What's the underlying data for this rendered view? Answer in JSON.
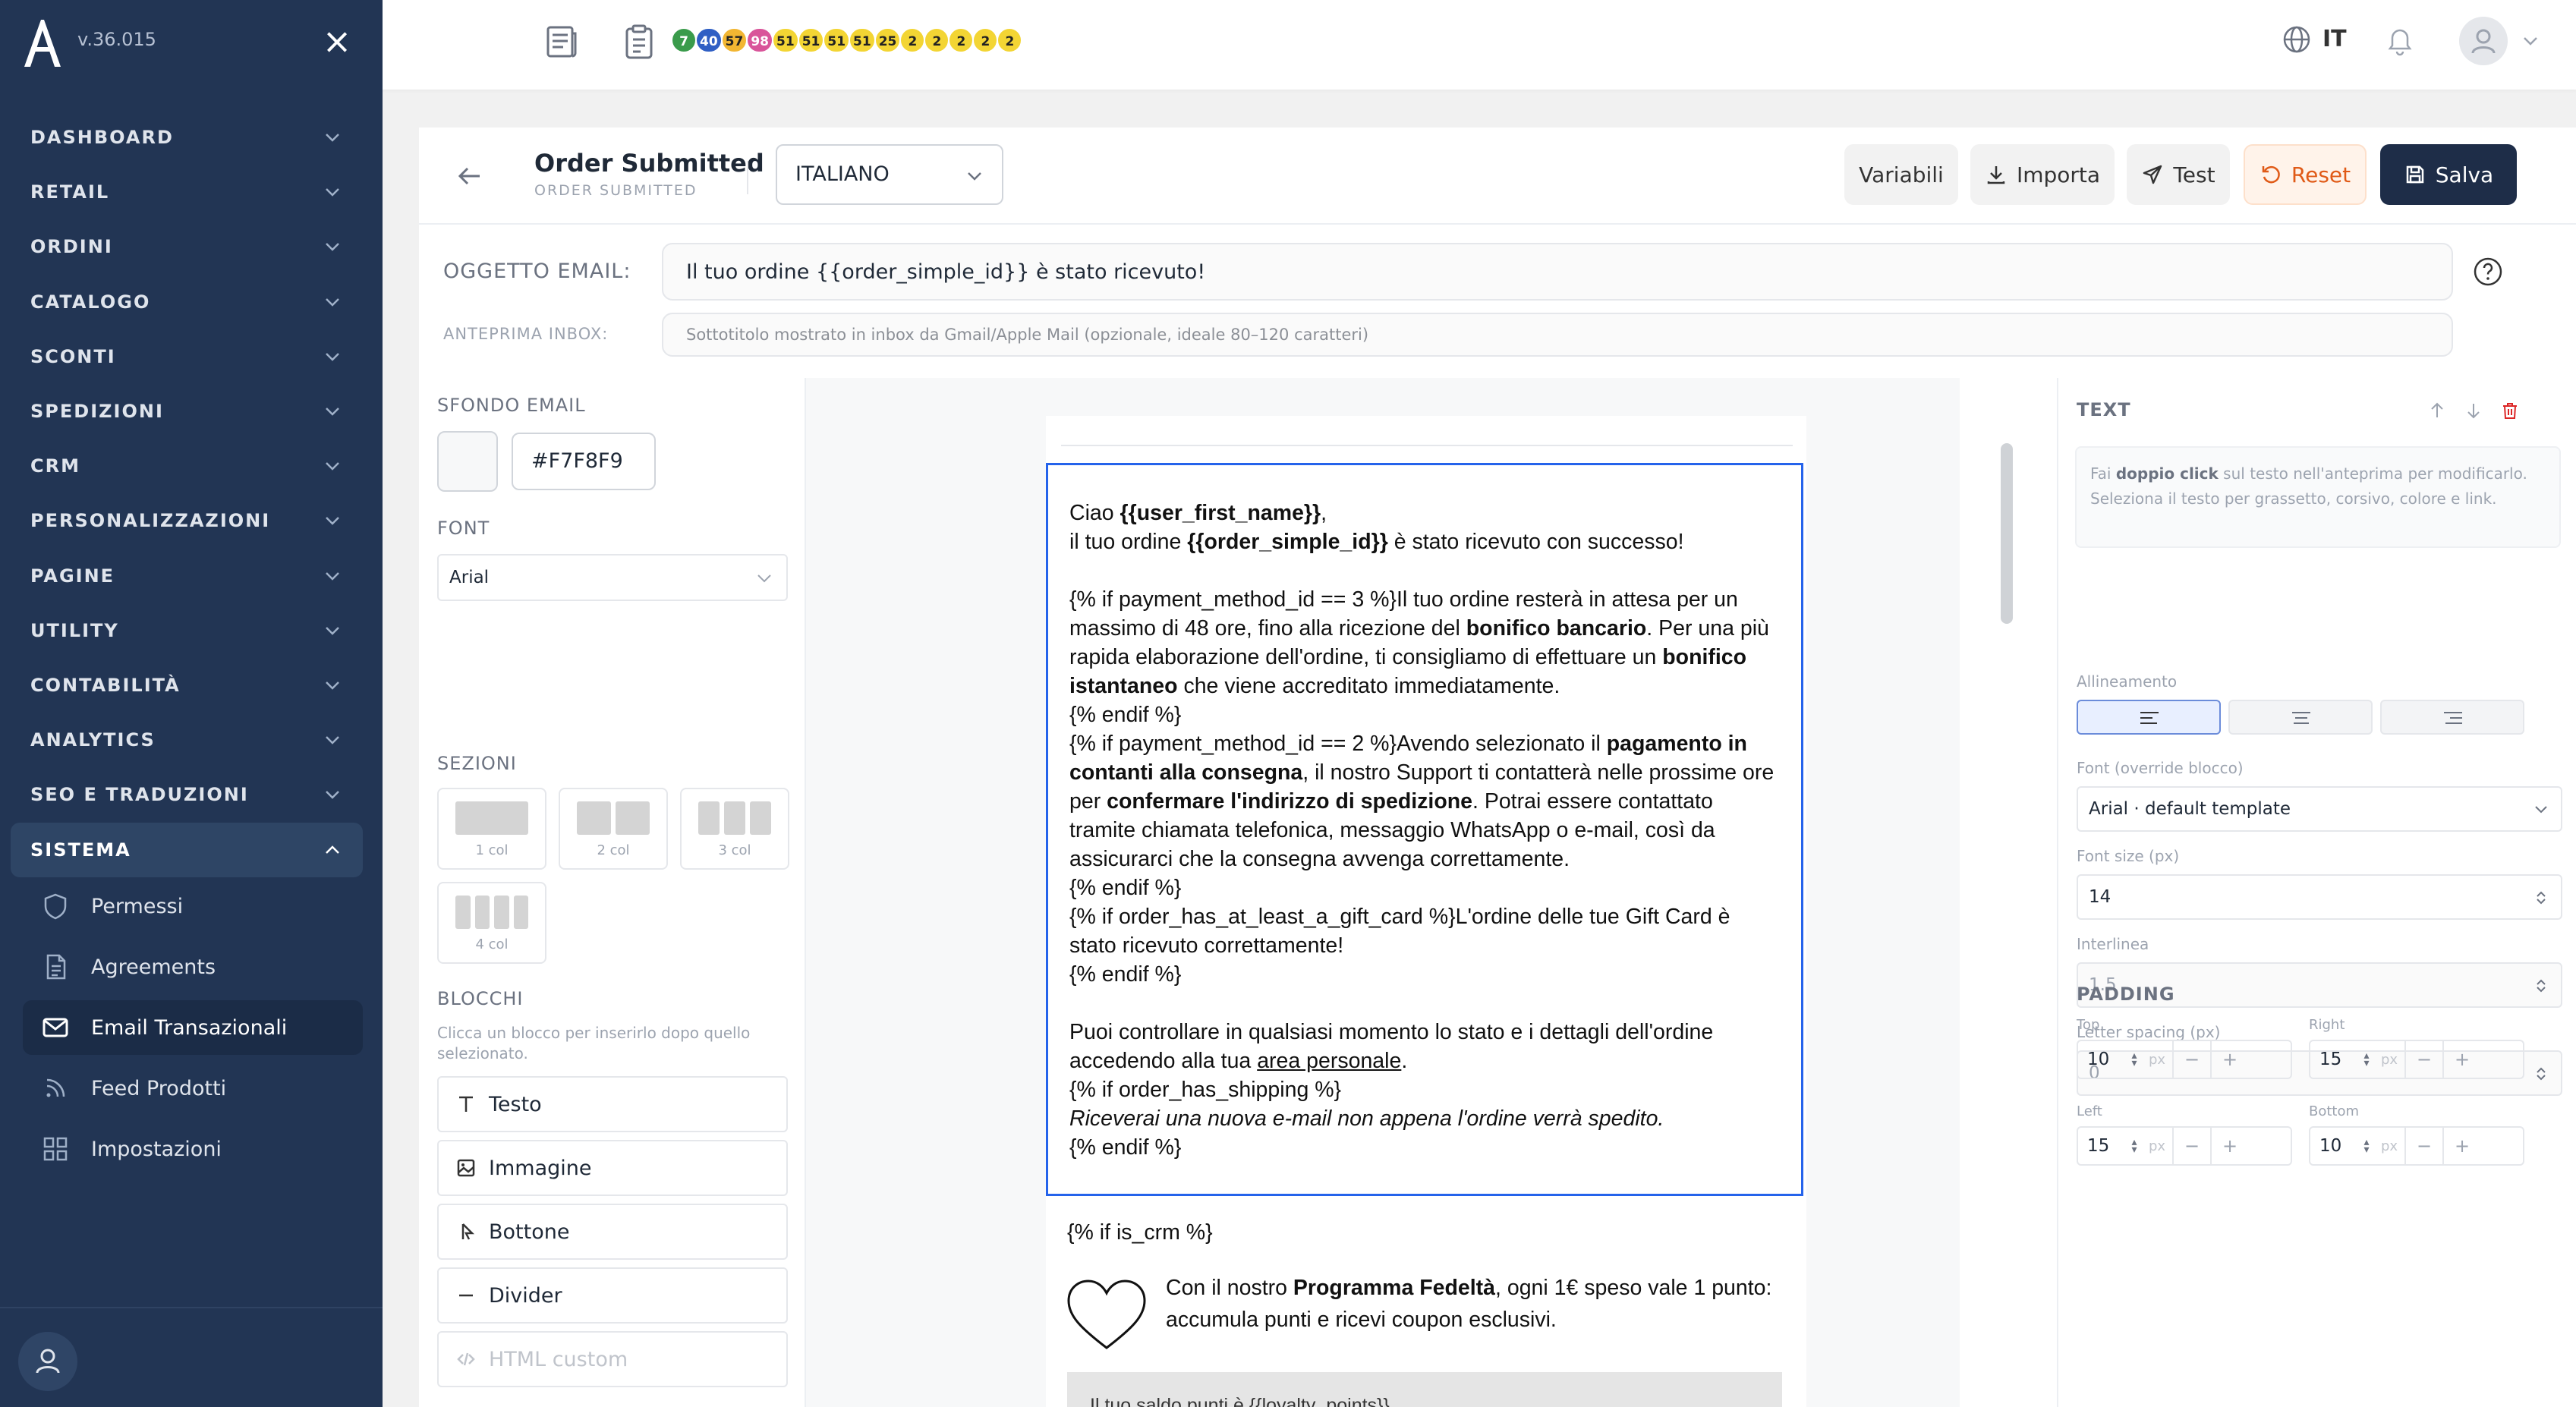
{
  "sidebar": {
    "version": "v.36.015",
    "nav": [
      {
        "label": "DASHBOARD"
      },
      {
        "label": "RETAIL"
      },
      {
        "label": "ORDINI"
      },
      {
        "label": "CATALOGO"
      },
      {
        "label": "SCONTI"
      },
      {
        "label": "SPEDIZIONI"
      },
      {
        "label": "CRM"
      },
      {
        "label": "PERSONALIZZAZIONI"
      },
      {
        "label": "PAGINE"
      },
      {
        "label": "UTILITY"
      },
      {
        "label": "CONTABILITÀ"
      },
      {
        "label": "ANALYTICS"
      },
      {
        "label": "SEO E TRADUZIONI"
      },
      {
        "label": "SISTEMA"
      }
    ],
    "sub": [
      {
        "label": "Permessi",
        "icon": "shield-icon"
      },
      {
        "label": "Agreements",
        "icon": "document-icon"
      },
      {
        "label": "Email Transazionali",
        "icon": "mail-icon"
      },
      {
        "label": "Feed Prodotti",
        "icon": "rss-icon"
      },
      {
        "label": "Impostazioni",
        "icon": "grid-icon"
      }
    ]
  },
  "topbar": {
    "badges": [
      {
        "text": "7",
        "bg": "#3a9b4b",
        "fg": "#fff"
      },
      {
        "text": "40",
        "bg": "#2f5fc4",
        "fg": "#fff"
      },
      {
        "text": "57",
        "bg": "#f2b632",
        "fg": "#222"
      },
      {
        "text": "98",
        "bg": "#d9559a",
        "fg": "#fff"
      },
      {
        "text": "51",
        "bg": "#f3d534",
        "fg": "#222"
      },
      {
        "text": "51",
        "bg": "#f3d534",
        "fg": "#222"
      },
      {
        "text": "51",
        "bg": "#f3d534",
        "fg": "#222"
      },
      {
        "text": "51",
        "bg": "#f3d534",
        "fg": "#222"
      },
      {
        "text": "25",
        "bg": "#f3d534",
        "fg": "#222"
      },
      {
        "text": "2",
        "bg": "#f3d534",
        "fg": "#222"
      },
      {
        "text": "2",
        "bg": "#f3d534",
        "fg": "#222"
      },
      {
        "text": "2",
        "bg": "#f3d534",
        "fg": "#222"
      },
      {
        "text": "2",
        "bg": "#f3d534",
        "fg": "#222"
      },
      {
        "text": "2",
        "bg": "#f3d534",
        "fg": "#222"
      }
    ],
    "language": "IT"
  },
  "header": {
    "title": "Order Submitted",
    "subtitle": "ORDER SUBMITTED",
    "language_select": "ITALIANO",
    "buttons": {
      "variables": "Variabili",
      "import": "Importa",
      "test": "Test",
      "reset": "Reset",
      "save": "Salva"
    }
  },
  "subject": {
    "label": "OGGETTO EMAIL:",
    "value": "Il tuo ordine {{order_simple_id}} è stato ricevuto!",
    "preview_label": "ANTEPRIMA INBOX:",
    "preview_placeholder": "Sottotitolo mostrato in inbox da Gmail/Apple Mail (opzionale, ideale 80–120 caratteri)"
  },
  "left": {
    "bg_label": "SFONDO EMAIL",
    "bg_hex": "#F7F8F9",
    "font_label": "FONT",
    "font_value": "Arial",
    "sections_label": "SEZIONI",
    "layouts": [
      "1 col",
      "2 col",
      "3 col",
      "4 col"
    ],
    "blocks_label": "BLOCCHI",
    "blocks_desc": "Clicca un blocco per inserirlo dopo quello selezionato.",
    "blocks": [
      "Testo",
      "Immagine",
      "Bottone",
      "Divider",
      "HTML custom"
    ]
  },
  "email": {
    "greet_a": "Ciao ",
    "greet_b": "{{user_first_name}}",
    "greet_c": ",",
    "order_a": "il tuo ordine ",
    "order_b": "{{order_simple_id}}",
    "order_c": " è stato ricevuto con successo!",
    "p1_a": "{% if payment_method_id == 3 %}Il tuo ordine resterà in attesa per un massimo di 48 ore, fino alla ricezione del ",
    "p1_b": "bonifico bancario",
    "p1_c": ". Per una più rapida elaborazione dell'ordine, ti consigliamo di effettuare un ",
    "p1_d": "bonifico istantaneo",
    "p1_e": " che viene accreditato immediatamente.",
    "endif1": "{% endif %}",
    "p2_a": "{% if payment_method_id == 2 %}Avendo selezionato il ",
    "p2_b": "pagamento in contanti alla consegna",
    "p2_c": ", il nostro Support ti contatterà nelle prossime ore per ",
    "p2_d": "confermare l'indirizzo di spedizione",
    "p2_e": ". Potrai essere contattato tramite chiamata telefonica, messaggio WhatsApp o e-mail, così da assicurarci che la consegna avvenga correttamente.",
    "endif2": "{% endif %}",
    "p3": "{% if order_has_at_least_a_gift_card %}L'ordine delle tue Gift Card è stato ricevuto correttamente!",
    "endif3": "{% endif %}",
    "p4_a": "Puoi controllare in qualsiasi momento lo stato e i dettagli dell'ordine accedendo alla tua ",
    "p4_link": "area personale",
    "p4_c": ".",
    "p5": "{% if order_has_shipping %}",
    "p5_i": "Riceverai una nuova e-mail non appena l'ordine verrà spedito.",
    "endif4": "{% endif %}",
    "crm": "{% if is_crm %}",
    "loyalty_a": "Con il nostro ",
    "loyalty_b": "Programma Fedeltà",
    "loyalty_c": ", ogni 1€ speso vale 1 punto: accumula punti e ricevi coupon esclusivi.",
    "balance": "Il tuo saldo punti è {{loyalty_points}}"
  },
  "right": {
    "title": "TEXT",
    "hint_a": "Fai ",
    "hint_b": "doppio click",
    "hint_c": " sul testo nell'anteprima per modificarlo.",
    "hint_d": "Seleziona il testo per grassetto, corsivo, colore e link.",
    "align_label": "Allineamento",
    "font_label": "Font (override blocco)",
    "font_value": "Arial · default template",
    "size_label": "Font size (px)",
    "size_value": "14",
    "line_label": "Interlinea",
    "line_value": "1.5",
    "ls_label": "Letter spacing (px)",
    "ls_value": "0",
    "padding_label": "PADDING",
    "pad_top_label": "Top",
    "pad_top": "10",
    "pad_right_label": "Right",
    "pad_right": "15",
    "pad_left_label": "Left",
    "pad_left": "15",
    "pad_bottom_label": "Bottom",
    "pad_bottom": "10",
    "unit": "px"
  }
}
